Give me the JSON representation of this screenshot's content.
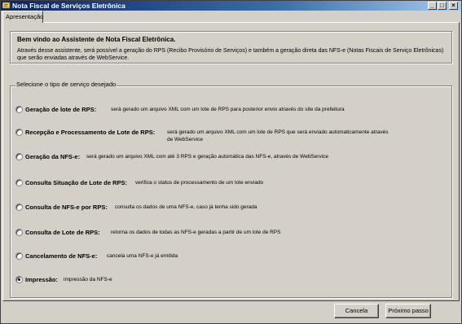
{
  "window": {
    "title": "Nota Fiscal de Serviços Eletrônica",
    "minimize_symbol": "_",
    "maximize_symbol": "□",
    "close_symbol": "×"
  },
  "tabs": [
    {
      "label": "Apresentação",
      "selected": true
    }
  ],
  "intro": {
    "title": "Bem vindo ao Assistente de Nota Fiscal Eletrônica.",
    "text": "Através desse assistente, será possível a geração do RPS (Recibo Provisório de Serviços) e também a geração direta das NFS-e (Notas Fiscais de Serviço Eletrônicas) que serão enviadas através de WebService."
  },
  "service_group": {
    "legend": "Selecione o tipo de serviço desejado",
    "options": [
      {
        "label": "Geração de lote de RPS:",
        "description": "será gerado um arquivo XML com um lote de RPS para posterior envio através do site da prefeitura",
        "checked": false
      },
      {
        "label": "Recepção e Processamento de Lote de RPS:",
        "description": "será gerado um arquivo XML com um lote de RPS que será enviado automaticamente através",
        "description2": "de WebService",
        "checked": false
      },
      {
        "label": "Geração da NFS-e:",
        "description": "será gerado um arquivo XML com até 3 RPS e geração automática das NFS-e, através de WebService",
        "checked": false
      },
      {
        "label": "Consulta Situação de Lote de RPS:",
        "description": "verifica o status de processamento de um lote enviado",
        "checked": false
      },
      {
        "label": "Consulta de NFS-e por RPS:",
        "description": "consulta os dados de uma NFS-e, caso já tenha sido gerada",
        "checked": false
      },
      {
        "label": "Consulta de Lote de RPS:",
        "description": "retorna os dados de todas as NFS-e geradas a partir de um lote de RPS",
        "checked": false
      },
      {
        "label": "Cancelamento de NFS-e:",
        "description": "cancela uma NFS-e já emitida",
        "checked": false
      },
      {
        "label": "Impressão:",
        "description": "impressão da NFS-e",
        "checked": true
      }
    ]
  },
  "buttons": {
    "cancel": "Cancela",
    "next": "Próximo passo"
  }
}
